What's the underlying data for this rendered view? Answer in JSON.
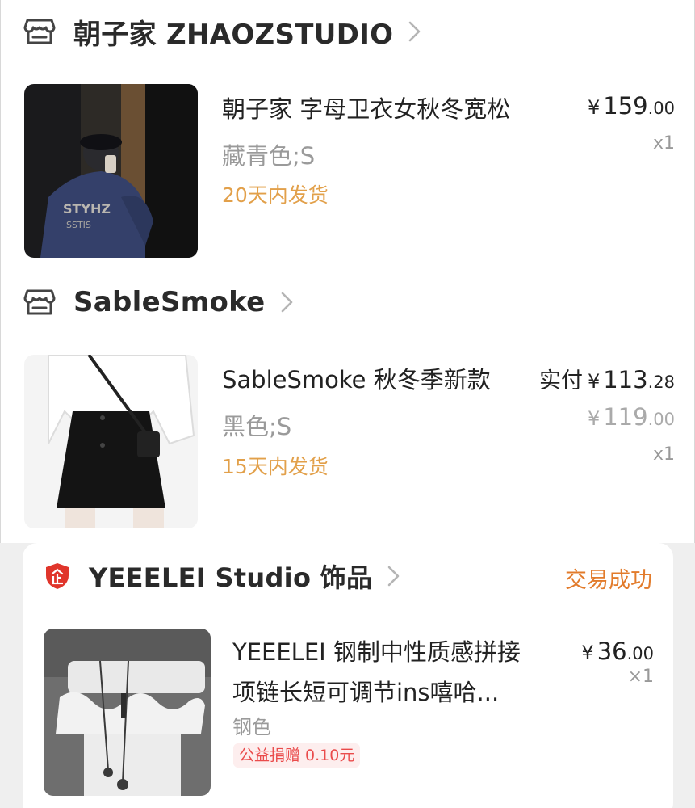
{
  "shops": [
    {
      "name": "朝子家 ZHAOZSTUDIO",
      "item": {
        "title": "朝子家 字母卫衣女秋冬宽松",
        "sku": "藏青色;S",
        "ship": "20天内发货",
        "price_symbol": "¥",
        "price_int": "159",
        "price_dec": ".00",
        "qty": "x1"
      }
    },
    {
      "name": "SableSmoke",
      "item": {
        "title": "SableSmoke 秋冬季新款",
        "sku": "黑色;S",
        "ship": "15天内发货",
        "paid_label": "实付",
        "price_symbol": "¥",
        "price_int": "113",
        "price_dec": ".28",
        "orig_symbol": "¥",
        "orig_int": "119",
        "orig_dec": ".00",
        "qty": "x1"
      }
    }
  ],
  "order": {
    "shop_name": "YEEELEI Studio 饰品",
    "status": "交易成功",
    "item": {
      "title_line1": "YEEELEI 钢制中性质感拼接",
      "title_line2": "项链长短可调节ins嘻哈...",
      "sku": "钢色",
      "badge": "公益捐赠 0.10元",
      "price_symbol": "¥",
      "price_int": "36",
      "price_dec": ".00",
      "qty": "×1"
    }
  },
  "colors": {
    "ship_orange": "#e2a04a",
    "status_orange": "#e27b2b",
    "shield_red": "#e0352b",
    "badge_red": "#ea4b4b"
  },
  "icons": [
    "store-icon",
    "chevron-right-icon",
    "shield-enterprise-icon"
  ]
}
